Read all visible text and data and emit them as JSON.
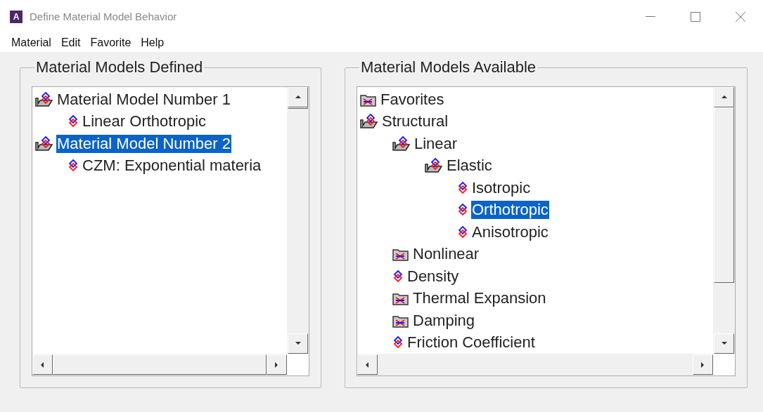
{
  "window": {
    "title": "Define Material Model Behavior",
    "app_icon_letter": "A"
  },
  "menu": [
    "Material",
    "Edit",
    "Favorite",
    "Help"
  ],
  "defined": {
    "title": "Material Models Defined",
    "items": [
      {
        "label": "Material Model Number 1",
        "kind": "open-folder",
        "selected": false,
        "children": [
          {
            "label": "Linear Orthotropic",
            "kind": "leaf",
            "selected": false
          }
        ]
      },
      {
        "label": "Material Model Number 2",
        "kind": "open-folder",
        "selected": true,
        "children": [
          {
            "label": "CZM: Exponential materia",
            "kind": "leaf",
            "selected": false
          }
        ]
      }
    ]
  },
  "available": {
    "title": "Material Models Available",
    "items": [
      {
        "label": "Favorites",
        "kind": "closed-folder",
        "selected": false
      },
      {
        "label": "Structural",
        "kind": "open-folder",
        "selected": false,
        "children": [
          {
            "label": "Linear",
            "kind": "open-folder",
            "selected": false,
            "children": [
              {
                "label": "Elastic",
                "kind": "open-folder",
                "selected": false,
                "children": [
                  {
                    "label": "Isotropic",
                    "kind": "leaf",
                    "selected": false
                  },
                  {
                    "label": "Orthotropic",
                    "kind": "leaf",
                    "selected": true
                  },
                  {
                    "label": "Anisotropic",
                    "kind": "leaf",
                    "selected": false
                  }
                ]
              }
            ]
          },
          {
            "label": "Nonlinear",
            "kind": "closed-folder",
            "selected": false
          },
          {
            "label": "Density",
            "kind": "leaf",
            "selected": false
          },
          {
            "label": "Thermal Expansion",
            "kind": "closed-folder",
            "selected": false
          },
          {
            "label": "Damping",
            "kind": "closed-folder",
            "selected": false
          },
          {
            "label": "Friction Coefficient",
            "kind": "leaf",
            "selected": false
          }
        ]
      }
    ]
  }
}
